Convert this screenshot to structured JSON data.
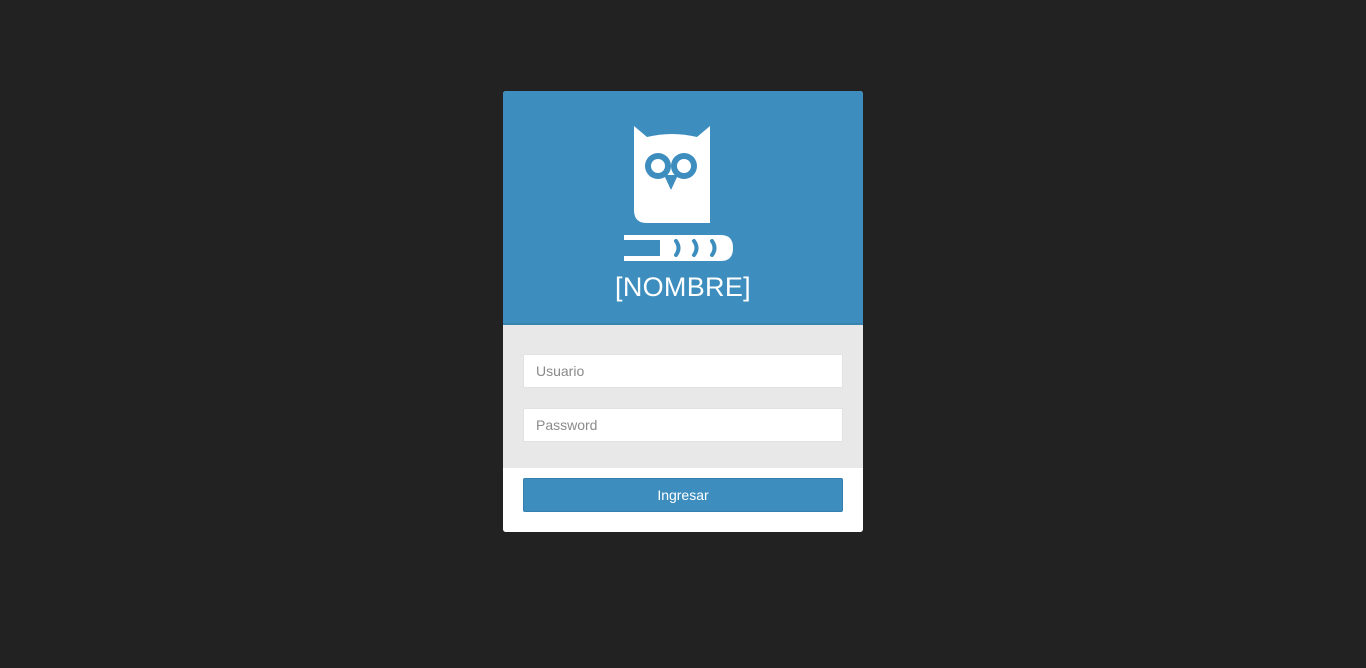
{
  "header": {
    "logo_icon": "owl-on-book-icon",
    "app_name": "[NOMBRE]"
  },
  "form": {
    "username": {
      "value": "",
      "placeholder": "Usuario"
    },
    "password": {
      "value": "",
      "placeholder": "Password"
    },
    "submit_label": "Ingresar"
  },
  "colors": {
    "background": "#222222",
    "accent": "#3d8ebf",
    "form_panel": "#e8e8e9"
  }
}
